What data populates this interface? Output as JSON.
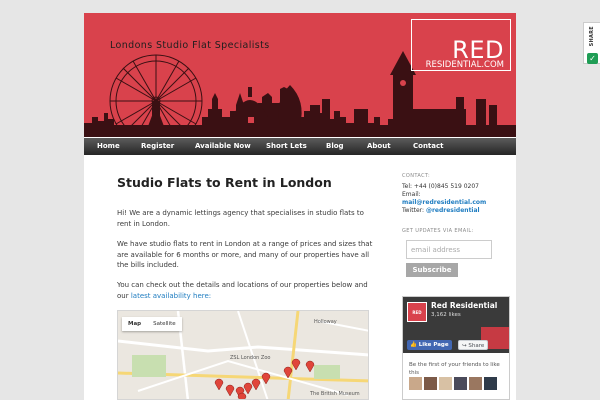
{
  "header": {
    "tagline": "Londons Studio Flat Specialists",
    "logo_main": "RED",
    "logo_sub": "RESIDENTIAL.COM"
  },
  "nav": {
    "items": [
      "Home",
      "Register",
      "Available Now",
      "Short Lets",
      "Blog",
      "About",
      "Contact"
    ]
  },
  "main": {
    "title": "Studio Flats to Rent in London",
    "p1": "Hi! We are a dynamic lettings agency that specialises in studio flats to rent in London.",
    "p2": "We have studio flats to rent in London at a range of prices and sizes that are available for 6 months or more, and many of our properties have all the bills included.",
    "p3": "You can check out the details and locations of our properties below and our",
    "p3_link": "latest availability here:",
    "map": {
      "tab_map": "Map",
      "tab_satellite": "Satellite",
      "labels": [
        "Holloway",
        "ZSL London Zoo",
        "The British Museum"
      ]
    }
  },
  "sidebar": {
    "contact_title": "CONTACT:",
    "tel": "Tel: +44 (0)845 519 0207",
    "email_label": "Email:",
    "email": "mail@redresidential.com",
    "twitter_label": "Twitter:",
    "twitter": "@redresidential",
    "updates_title": "GET UPDATES VIA EMAIL:",
    "email_placeholder": "email address",
    "subscribe": "Subscribe"
  },
  "facebook": {
    "page_name": "Red Residential",
    "likes": "3,162 likes",
    "like_button": "Like Page",
    "share_button": "Share",
    "friends_text": "Be the first of your friends to like this"
  },
  "share_widget": {
    "label": "SHARE"
  },
  "colors": {
    "brand_red": "#d9424c",
    "link_blue": "#1e7cc0",
    "fb_blue": "#4267b2"
  }
}
